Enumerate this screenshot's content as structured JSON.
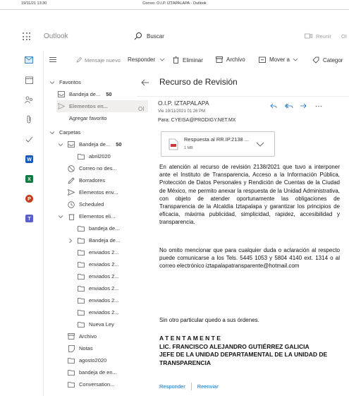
{
  "window": {
    "timestamp": "19/11/21 13:30",
    "title": "Correo: O.I.P. IZTAPALAPA - Outlook"
  },
  "header": {
    "app_name": "Outlook",
    "search_label": "Buscar",
    "meet_label": "Reunir",
    "meet_extra": "OI"
  },
  "commandbar": {
    "new_mail": "Mensaje nuevo",
    "reply": "Responder",
    "delete": "Eliminar",
    "archive": "Archivo",
    "move": "Mover a",
    "categorize": "Categor"
  },
  "folders": {
    "favorites_header": "Favoritos",
    "favorites": [
      {
        "label": "Bandeja de...",
        "count": "50"
      },
      {
        "label": "Elementos en..."
      },
      {
        "label": "Agregar favorito"
      }
    ],
    "folders_header": "Carpetas",
    "items": [
      {
        "label": "Bandeja de...",
        "count": "50"
      },
      {
        "label": "abril2020"
      },
      {
        "label": "Correo no des..."
      },
      {
        "label": "Borradores"
      },
      {
        "label": "Elementos env..."
      },
      {
        "label": "Scheduled"
      },
      {
        "label": "Elementos eli..."
      },
      {
        "label": "bandeja de..."
      },
      {
        "label": "Bandeja de..."
      },
      {
        "label": "enviados 2..."
      },
      {
        "label": "enviados 2..."
      },
      {
        "label": "enviados 2..."
      },
      {
        "label": "enviados 2..."
      },
      {
        "label": "enviados 2..."
      },
      {
        "label": "enviados 2..."
      },
      {
        "label": "Nueva Ley"
      },
      {
        "label": "Archivo"
      },
      {
        "label": "Notas"
      },
      {
        "label": "agosto2020"
      },
      {
        "label": "bandeja de en..."
      },
      {
        "label": "Conversation..."
      }
    ]
  },
  "message": {
    "subject": "Recurso de Revisión",
    "avatar": "OI",
    "sender": "O.I.P. IZTAPALAPA",
    "date": "Vie 19/11/2021 01:26 PM",
    "to": "Para:  CYEISA@PRODIGY.NET.MX",
    "attachment": {
      "name": "Respuesta al RR.IP.2138 ...",
      "size": "1 MB"
    },
    "paragraph1": "En atención al recurso de revisión 2138/2021 que tuvo a interponer ante el Instituto de Transparencia, Acceso a la Información Pública, Protección de Datos Personales y Rendición de Cuentas de la Ciudad de México, me permito anexar la respuesta de la Unidad Administrativa, con objeto de atender oportunamente las obligaciones de Transparencia de la Alcaldía Iztapalapa y garantizar los principios de eficacia, máxima publicidad, simplicidad, rapidez, accesibilidad y transparencia.",
    "paragraph2": "No omito mencionar que para cualquier duda o aclaración al respecto puede comunicarse a los Tels. 5445 1053 y 5804 4140 ext. 1314 o al correo electrónico iztapalapatransparente@hotmail.com",
    "closing": "Sin otro particular quedo a sus órdenes.",
    "signature": [
      "A T E N T A M E N T E",
      "LIC. FRANCISCO ALEJANDRO GUTIÉRREZ GALICIA",
      "JEFE DE LA UNIDAD DEPARTAMENTAL DE LA UNIDAD DE TRANSPARENCIA"
    ],
    "reply_label": "Responder",
    "forward_label": "Reenviar"
  },
  "colors": {
    "accent": "#0f6cbd",
    "rail_word": "#185abd",
    "rail_excel": "#107c41",
    "rail_ppt": "#c43e1c",
    "rail_teams": "#5b5fc7"
  }
}
